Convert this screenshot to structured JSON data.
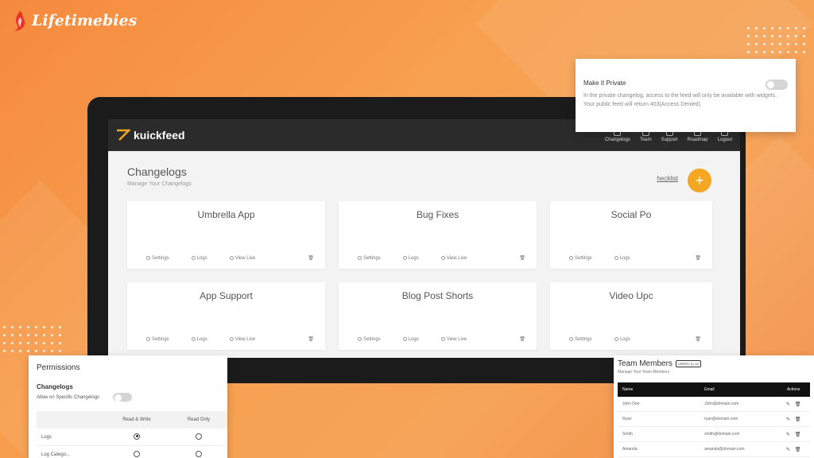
{
  "brand": {
    "name": "Lifetimebies"
  },
  "app": {
    "logo": "kuickfeed",
    "nav": [
      "Changelogs",
      "Team",
      "Support",
      "Roadmap",
      "Logout"
    ],
    "page_title": "Changelogs",
    "page_subtitle": "Manage Your Changelogs",
    "checklist": "hecklist",
    "add_icon": "+",
    "cards": [
      {
        "title": "Umbrella App",
        "actions": [
          "Settings",
          "Logs",
          "View Live"
        ]
      },
      {
        "title": "Bug Fixes",
        "actions": [
          "Settings",
          "Logs",
          "View Live"
        ]
      },
      {
        "title": "Social Po",
        "actions": [
          "Settings",
          "Logs"
        ]
      },
      {
        "title": "App Support",
        "actions": [
          "Settings",
          "Logs",
          "View Live"
        ]
      },
      {
        "title": "Blog Post Shorts",
        "actions": [
          "Settings",
          "Logs",
          "View Live"
        ]
      },
      {
        "title": "Video Upc",
        "actions": [
          "Settings",
          "Logs"
        ]
      }
    ]
  },
  "private_panel": {
    "title": "Make It Private",
    "description": "In the private changelog, access to the feed will only be available with widgets. Your public feed will return 403(Access Denied)."
  },
  "permissions": {
    "title": "Permissions",
    "subtitle": "Changelogs",
    "allow_label": "Allow on Specific Changelogs",
    "columns": [
      "",
      "Read & Write",
      "Read Only"
    ],
    "rows": [
      {
        "label": "Logs",
        "read_write": true,
        "read_only": false
      },
      {
        "label": "Log Catego...",
        "read_write": false,
        "read_only": false
      }
    ]
  },
  "team": {
    "title": "Team Members",
    "badge": "USERS: 5 | 10",
    "subtitle": "Manage Your Team Members",
    "columns": [
      "Name",
      "Email",
      "Actions"
    ],
    "rows": [
      {
        "name": "John Doe",
        "email": "John@domain.com"
      },
      {
        "name": "Ryan",
        "email": "ryan@domain.com"
      },
      {
        "name": "Smith",
        "email": "smith@domain.com"
      },
      {
        "name": "Amanda",
        "email": "amanda@domain.com"
      }
    ]
  },
  "colors": {
    "accent": "#f5a623",
    "background": "#f7a04f",
    "dark": "#2b2b2b"
  }
}
